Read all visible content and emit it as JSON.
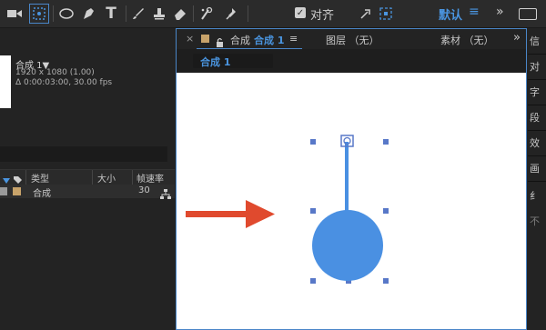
{
  "colors": {
    "accent": "#4a95e0",
    "selection_blue": "#4a86c8",
    "shape_fill": "#4a90e2",
    "arrow_red": "#e04a2e",
    "canvas_white": "#ffffff",
    "panel_bg": "#232323"
  },
  "toolbar": {
    "tools": [
      "video-camera-icon",
      "selection-tool-icon",
      "ellipse-tool-icon",
      "pen-tool-icon",
      "type-tool-icon",
      "brush-tool-icon",
      "clone-stamp-icon",
      "eraser-icon",
      "roto-brush-icon",
      "puppet-pin-icon"
    ],
    "align_label": "对齐",
    "align_checked": true,
    "workspace_label": "默认",
    "menu_glyph": "≡",
    "more_glyph": "»"
  },
  "project": {
    "comp_name": "合成 1▼",
    "comp_resolution": "1920 x 1080 (1.00)",
    "comp_duration": "Δ 0:00:03:00, 30.00 fps",
    "columns": [
      "类型",
      "大小",
      "帧速率"
    ],
    "items": [
      {
        "name": "合成",
        "fps": "30"
      }
    ]
  },
  "composition": {
    "close_glyph": "×",
    "tab_title": "合成",
    "tab_active": "合成 1",
    "menu_glyph": "≡",
    "layer_tab": "图层 （无）",
    "footage_tab": "素材 （无）",
    "more_glyph": "»",
    "subtab_label": "合成 1"
  },
  "right_panel": {
    "items": [
      "信",
      "对",
      "字",
      "段",
      "效",
      "画",
      "纟",
      "不"
    ]
  }
}
